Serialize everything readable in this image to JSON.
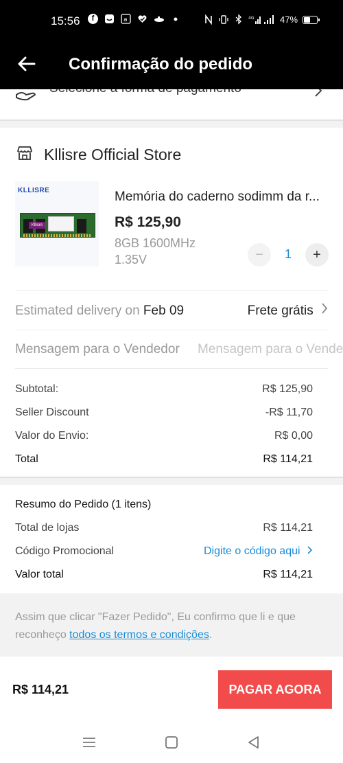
{
  "status_bar": {
    "time": "15:56",
    "icons": [
      "facebook-icon",
      "chat-icon",
      "amazon-icon",
      "heart-check-icon",
      "submarine-icon",
      "dot-icon"
    ],
    "right_icons": [
      "nfc-icon",
      "vibrate-icon",
      "bluetooth-icon",
      "signal-4g-icon",
      "signal-icon"
    ],
    "battery_percent": "47%"
  },
  "app_bar": {
    "title": "Confirmação do pedido"
  },
  "payment_row": {
    "label": "Selecione a forma de pagamento"
  },
  "store": {
    "name": "Kllisre Official Store"
  },
  "product": {
    "thumb_brand": "KLLISRE",
    "thumb_tag": "Kllisre",
    "name": "Memória do caderno sodimm da r...",
    "price": "R$ 125,90",
    "variant": "8GB 1600MHz 1.35V",
    "quantity": "1",
    "minus": "−",
    "plus": "+"
  },
  "delivery": {
    "label": "Estimated delivery on ",
    "date": "Feb 09",
    "freight": "Frete grátis"
  },
  "message": {
    "label": "Mensagem para o Vendedor",
    "placeholder": "Mensagem para o Vendedor"
  },
  "store_summary": {
    "subtotal_label": "Subtotal:",
    "subtotal_value": "R$ 125,90",
    "discount_label": "Seller Discount",
    "discount_value": "-R$ 11,70",
    "shipping_label": "Valor do Envio:",
    "shipping_value": "R$ 0,00",
    "total_label": "Total",
    "total_value": "R$ 114,21"
  },
  "order_summary": {
    "title": "Resumo do Pedido (1 itens)",
    "stores_total_label": "Total de lojas",
    "stores_total_value": "R$ 114,21",
    "promo_label": "Código Promocional",
    "promo_link": "Digite o código aqui",
    "grand_total_label": "Valor total",
    "grand_total_value": "R$ 114,21"
  },
  "terms": {
    "text": "Assim que clicar \"Fazer Pedido\", Eu confirmo que li e que reconheço ",
    "link": "todos os termos e condições",
    "end": "."
  },
  "checkout": {
    "total": "R$ 114,21",
    "button": "PAGAR AGORA"
  },
  "colors": {
    "accent_blue": "#1a8bd8",
    "pay_red": "#f24b4b",
    "header_black": "#000000"
  }
}
